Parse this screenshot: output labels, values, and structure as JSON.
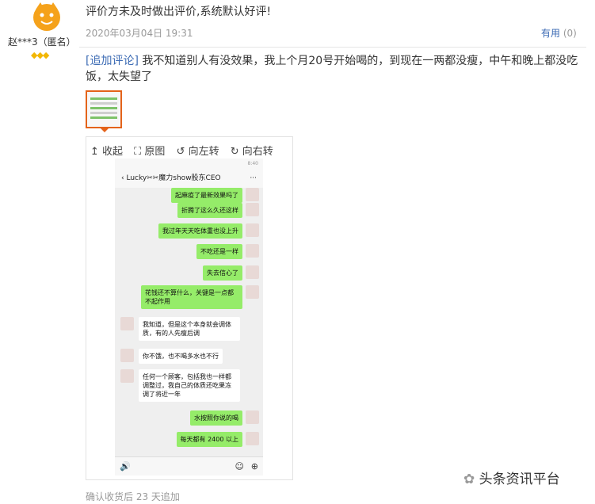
{
  "review": {
    "user_name": "赵***3（匿名）",
    "level_icon": "diamond-icon",
    "first_text": "评价方未及时做出评价,系统默认好评!",
    "date": "2020年03月04日 19:31",
    "useful_label": "有用",
    "useful_count": "(0)",
    "addition_tag": "[追加评论]",
    "addition_text": "我不知道别人有没效果，我上个月20号开始喝的，到现在一两都没瘦，中午和晚上都没吃饭，太失望了",
    "footer": "确认收货后 23 天追加"
  },
  "viewer": {
    "collapse": "↥ 收起",
    "original": "⛶ 原图",
    "rotate_left": "↺ 向左转",
    "rotate_right": "↻ 向右转"
  },
  "chat": {
    "time": "8:40",
    "back_icon": "‹",
    "title": "Lucky✂✂魔力show股东CEO",
    "more": "···",
    "messages": [
      {
        "side": "out",
        "text": "起麻疫了最新效果吗了"
      },
      {
        "side": "out",
        "text": "折腾了这么久还这样"
      },
      {
        "side": "out",
        "text": "我过年天天吃体重也没上升"
      },
      {
        "side": "out",
        "text": "不吃还是一样"
      },
      {
        "side": "out",
        "text": "失去信心了"
      },
      {
        "side": "out",
        "text": "花钱还不算什么，关键是一点都不起作用"
      },
      {
        "side": "in",
        "text": "我知道，但是这个本身就会调体质，有的人先瘦后调"
      },
      {
        "side": "in",
        "text": "你不饿，也不喝多水也不行"
      },
      {
        "side": "in",
        "text": "任何一个顾客，包括我也一样都调整过，我自己的体质还吃果冻调了将近一年"
      },
      {
        "side": "out",
        "text": "水按照你说的喝"
      },
      {
        "side": "out",
        "text": "每天都有 2400 以上"
      }
    ],
    "voice_icon": "🔊",
    "emoji_icon": "☺",
    "plus_icon": "⊕"
  },
  "watermark": "头条资讯平台"
}
